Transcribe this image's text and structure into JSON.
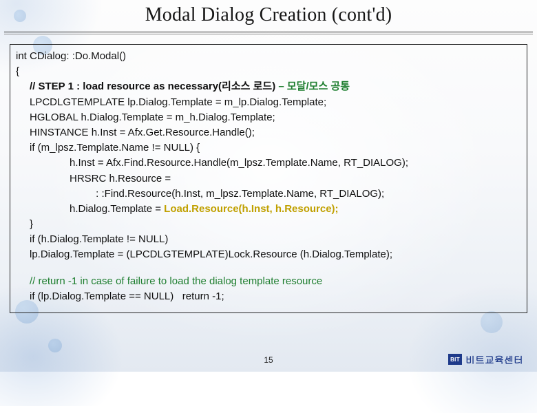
{
  "title": "Modal Dialog Creation (cont'd)",
  "code": {
    "l1": "int CDialog: :Do.Modal()",
    "l2": "{",
    "stepPrefix": "// STEP 1 : load resource as necessary(리소스 로드)",
    "stepSuffix": " – 모달/모스 공통",
    "l4": "LPCDLGTEMPLATE lp.Dialog.Template = m_lp.Dialog.Template;",
    "l5": "HGLOBAL h.Dialog.Template = m_h.Dialog.Template;",
    "l6": "HINSTANCE h.Inst = Afx.Get.Resource.Handle();",
    "l7": "if (m_lpsz.Template.Name != NULL) {",
    "l8": "h.Inst = Afx.Find.Resource.Handle(m_lpsz.Template.Name, RT_DIALOG);",
    "l9": "HRSRC h.Resource =",
    "l10": " : :Find.Resource(h.Inst, m_lpsz.Template.Name, RT_DIALOG);",
    "l11a": "h.Dialog.Template = ",
    "l11b": "Load.Resource(h.Inst, h.Resource);",
    "l12": "}",
    "l13": "if (h.Dialog.Template != NULL)",
    "l14": "lp.Dialog.Template = (LPCDLGTEMPLATE)Lock.Resource (h.Dialog.Template);",
    "l15": "// return -1 in case of failure to load the dialog template resource",
    "l16": "if (lp.Dialog.Template == NULL)   return -1;"
  },
  "page_number": "15",
  "brand_logo_text": "BIT",
  "brand_text": "비트교육센터"
}
